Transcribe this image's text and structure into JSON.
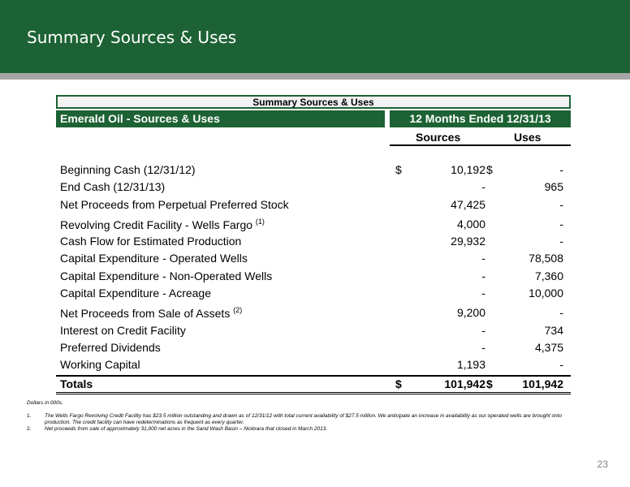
{
  "slide_title": "Summary Sources & Uses",
  "table": {
    "title": "Summary Sources & Uses",
    "company_header": "Emerald Oil - Sources & Uses",
    "period_header": "12 Months Ended 12/31/13",
    "col_sources": "Sources",
    "col_uses": "Uses",
    "rows": [
      {
        "label": "Beginning Cash (12/31/12)",
        "note": "",
        "src_dollar": "$",
        "sources": "10,192",
        "use_dollar": "$",
        "uses": "-"
      },
      {
        "label": "End Cash (12/31/13)",
        "note": "",
        "src_dollar": "",
        "sources": "-",
        "use_dollar": "",
        "uses": "965"
      },
      {
        "label": "Net Proceeds from Perpetual Preferred Stock",
        "note": "",
        "src_dollar": "",
        "sources": "47,425",
        "use_dollar": "",
        "uses": "-"
      },
      {
        "label": "Revolving Credit Facility - Wells Fargo",
        "note": "(1)",
        "src_dollar": "",
        "sources": "4,000",
        "use_dollar": "",
        "uses": "-"
      },
      {
        "label": "Cash Flow for Estimated Production",
        "note": "",
        "src_dollar": "",
        "sources": "29,932",
        "use_dollar": "",
        "uses": "-"
      },
      {
        "label": "Capital Expenditure - Operated Wells",
        "note": "",
        "src_dollar": "",
        "sources": "-",
        "use_dollar": "",
        "uses": "78,508"
      },
      {
        "label": "Capital Expenditure - Non-Operated Wells",
        "note": "",
        "src_dollar": "",
        "sources": "-",
        "use_dollar": "",
        "uses": "7,360"
      },
      {
        "label": "Capital Expenditure - Acreage",
        "note": "",
        "src_dollar": "",
        "sources": "-",
        "use_dollar": "",
        "uses": "10,000"
      },
      {
        "label": "Net Proceeds from Sale of Assets",
        "note": "(2)",
        "src_dollar": "",
        "sources": "9,200",
        "use_dollar": "",
        "uses": "-"
      },
      {
        "label": "Interest on Credit Facility",
        "note": "",
        "src_dollar": "",
        "sources": "-",
        "use_dollar": "",
        "uses": "734"
      },
      {
        "label": "Preferred Dividends",
        "note": "",
        "src_dollar": "",
        "sources": "-",
        "use_dollar": "",
        "uses": "4,375"
      },
      {
        "label": "Working Capital",
        "note": "",
        "src_dollar": "",
        "sources": "1,193",
        "use_dollar": "",
        "uses": "-"
      }
    ],
    "totals": {
      "label": "Totals",
      "src_dollar": "$",
      "sources": "101,942",
      "use_dollar": "$",
      "uses": "101,942"
    }
  },
  "footnotes": {
    "units": "Dollars in 000s.",
    "items": [
      {
        "num": "1.",
        "text": "The Wells Fargo Revolving Credit Facility has $23.5 million outstanding and drawn as of 12/31/12 with total current availability of $27.5 million. We anticipate an increase in availability as our operated wells are brought onto production. The credit facility can have redeterminations as frequent as every quarter."
      },
      {
        "num": "2.",
        "text": "Net proceeds from sale of approximately 31,000 net acres in the Sand Wash Basin – Niobrara that closed in March 2013."
      }
    ]
  },
  "page_number": "23",
  "colors": {
    "brand_green": "#1d6234",
    "rule_gray": "#a6a6a6"
  }
}
